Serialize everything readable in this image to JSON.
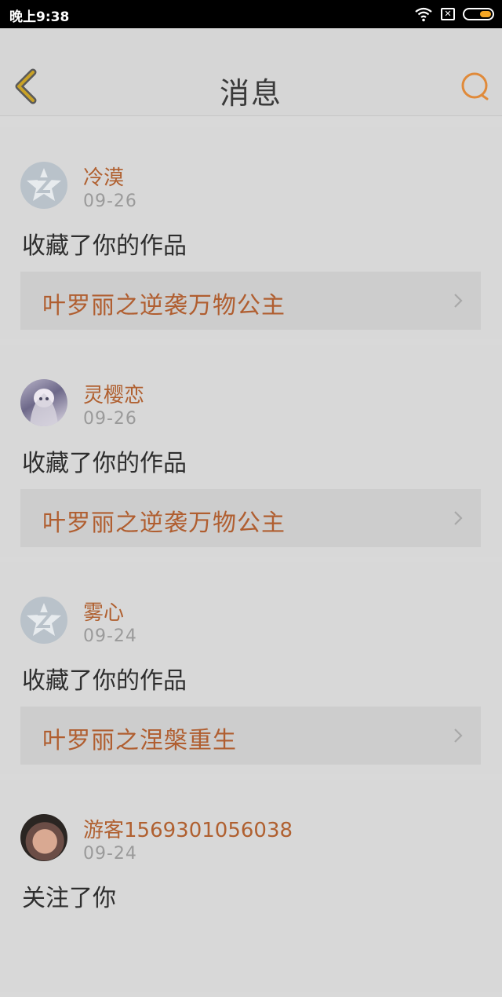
{
  "status_bar": {
    "time": "晚上9:38"
  },
  "header": {
    "title": "消息"
  },
  "messages": [
    {
      "user": "冷漠",
      "date": "09-26",
      "action": "收藏了你的作品",
      "work": "叶罗丽之逆袭万物公主",
      "avatar": "default-avatar-icon"
    },
    {
      "user": "灵樱恋",
      "date": "09-26",
      "action": "收藏了你的作品",
      "work": "叶罗丽之逆袭万物公主",
      "avatar": "anime-avatar"
    },
    {
      "user": "雾心",
      "date": "09-24",
      "action": "收藏了你的作品",
      "work": "叶罗丽之涅槃重生",
      "avatar": "default-avatar-icon"
    },
    {
      "user": "游客1569301056038",
      "date": "09-24",
      "action": "关注了你",
      "avatar": "baby-photo-avatar"
    }
  ],
  "colors": {
    "accent": "#b06030",
    "back_icon": "#c9a227",
    "search_icon": "#e08a3a"
  }
}
